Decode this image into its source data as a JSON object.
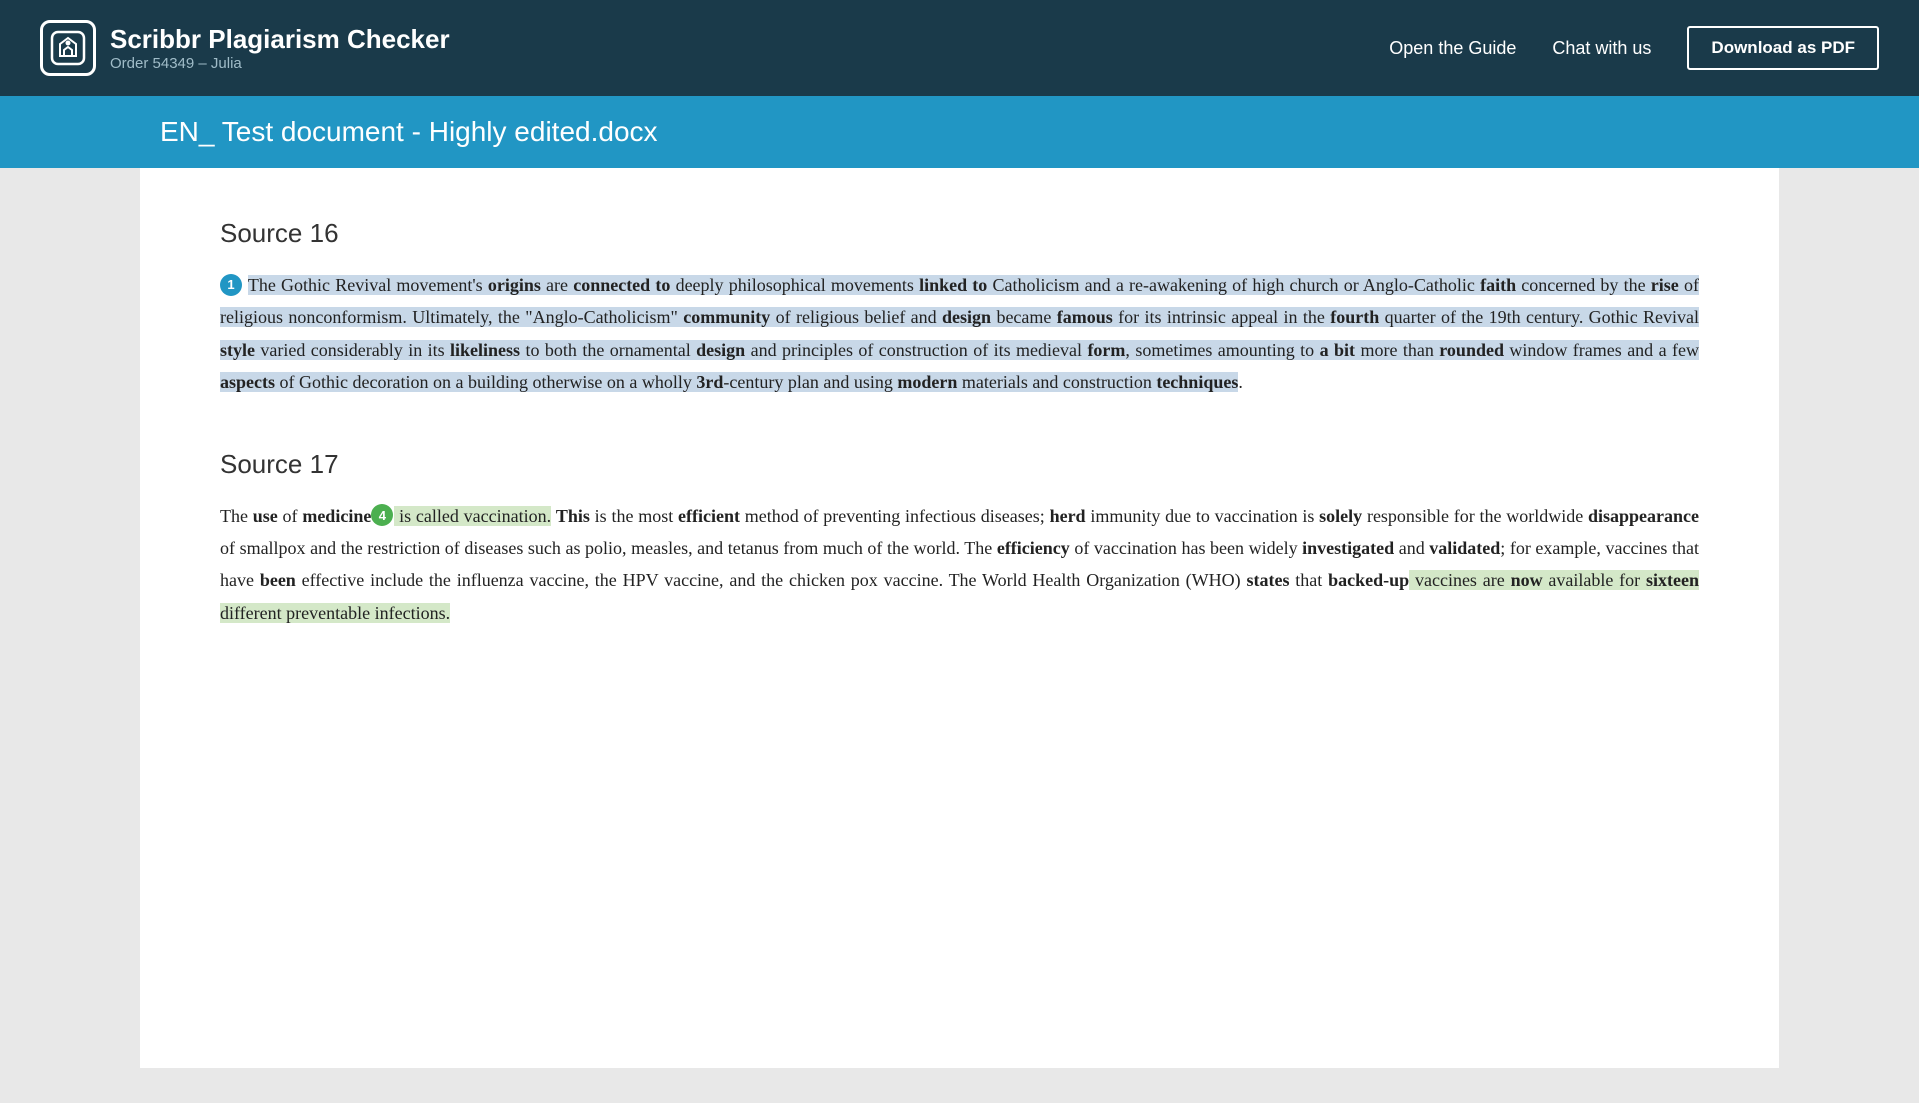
{
  "header": {
    "logo_title": "Scribbr Plagiarism Checker",
    "order_info": "Order 54349 – Julia",
    "nav": {
      "guide": "Open the Guide",
      "chat": "Chat with us",
      "download": "Download as PDF"
    }
  },
  "title_bar": {
    "filename": "EN_ Test document - Highly edited.docx"
  },
  "sources": [
    {
      "id": "source16",
      "heading": "Source 16",
      "badge_number": "1",
      "badge_color": "blue",
      "paragraphs": [
        {
          "segments": [
            {
              "text": "The ",
              "style": "hl-blue"
            },
            {
              "text": "Gothic Revival movement's ",
              "style": "hl-blue"
            },
            {
              "text": "origins",
              "style": "hl-blue bold"
            },
            {
              "text": " are ",
              "style": "hl-blue"
            },
            {
              "text": "connected to",
              "style": "hl-blue bold"
            },
            {
              "text": " deeply philosophical movements ",
              "style": "hl-blue"
            },
            {
              "text": "linked to",
              "style": "hl-blue bold"
            },
            {
              "text": " Catholicism and a re-awakening of high church or Anglo-Catholic ",
              "style": "hl-blue"
            },
            {
              "text": "faith",
              "style": "hl-blue bold"
            },
            {
              "text": " concerned by the ",
              "style": "hl-blue"
            },
            {
              "text": "rise",
              "style": "hl-blue bold"
            },
            {
              "text": " of religious nonconformism. Ultimately, the \"Anglo-Catholicism\" ",
              "style": "hl-blue"
            },
            {
              "text": "community",
              "style": "hl-blue bold"
            },
            {
              "text": " of religious belief and ",
              "style": "hl-blue"
            },
            {
              "text": "design",
              "style": "hl-blue bold"
            },
            {
              "text": " became ",
              "style": "hl-blue"
            },
            {
              "text": "famous",
              "style": "hl-blue bold"
            },
            {
              "text": " for its intrinsic appeal in the ",
              "style": "hl-blue"
            },
            {
              "text": "fourth",
              "style": "hl-blue bold"
            },
            {
              "text": " quarter of the 19th century. Gothic Revival ",
              "style": "hl-blue"
            },
            {
              "text": "style",
              "style": "hl-blue bold"
            },
            {
              "text": " varied considerably in its ",
              "style": "hl-blue"
            },
            {
              "text": "likeliness",
              "style": "hl-blue bold"
            },
            {
              "text": " to both the ornamental ",
              "style": "hl-blue"
            },
            {
              "text": "design",
              "style": "hl-blue bold"
            },
            {
              "text": " and principles of construction of its medieval ",
              "style": "hl-blue"
            },
            {
              "text": "form",
              "style": "hl-blue bold"
            },
            {
              "text": ", sometimes amounting to ",
              "style": "hl-blue"
            },
            {
              "text": "a bit",
              "style": "hl-blue bold"
            },
            {
              "text": " more than ",
              "style": "hl-blue"
            },
            {
              "text": "rounded",
              "style": "hl-blue bold"
            },
            {
              "text": " window frames and a few ",
              "style": "hl-blue"
            },
            {
              "text": "aspects",
              "style": "hl-blue bold"
            },
            {
              "text": " of Gothic decoration on a building otherwise on a wholly ",
              "style": "hl-blue"
            },
            {
              "text": "3rd",
              "style": "hl-blue bold"
            },
            {
              "text": "-century plan and using ",
              "style": "hl-blue"
            },
            {
              "text": "modern",
              "style": "hl-blue bold"
            },
            {
              "text": " materials and construction ",
              "style": "hl-blue"
            },
            {
              "text": "techniques",
              "style": "hl-blue bold"
            },
            {
              "text": ".",
              "style": ""
            }
          ]
        }
      ]
    },
    {
      "id": "source17",
      "heading": "Source 17",
      "badge_number": "4",
      "badge_color": "green",
      "paragraphs": [
        {
          "segments": [
            {
              "text": "The ",
              "style": ""
            },
            {
              "text": "use",
              "style": "bold"
            },
            {
              "text": " of ",
              "style": ""
            },
            {
              "text": "medicine",
              "style": "bold"
            },
            {
              "text": " is called vaccination. ",
              "style": "hl-yellow"
            },
            {
              "text": "This",
              "style": "bold"
            },
            {
              "text": " is the most ",
              "style": ""
            },
            {
              "text": "efficient",
              "style": "bold"
            },
            {
              "text": " method of preventing infectious diseases; ",
              "style": ""
            },
            {
              "text": "herd",
              "style": "bold"
            },
            {
              "text": " immunity due to vaccination is ",
              "style": ""
            },
            {
              "text": "solely",
              "style": "bold"
            },
            {
              "text": " responsible for the worldwide ",
              "style": ""
            },
            {
              "text": "disappearance",
              "style": "bold"
            },
            {
              "text": " of smallpox and the restriction of diseases such as polio, measles, and tetanus from much of the world. The ",
              "style": ""
            },
            {
              "text": "efficiency",
              "style": "bold"
            },
            {
              "text": " of vaccination has been widely ",
              "style": ""
            },
            {
              "text": "investigated",
              "style": "bold"
            },
            {
              "text": " and ",
              "style": ""
            },
            {
              "text": "validated",
              "style": "bold"
            },
            {
              "text": "; for example, vaccines that have ",
              "style": ""
            },
            {
              "text": "been",
              "style": "bold"
            },
            {
              "text": " effective include the influenza vaccine, the HPV vaccine, and the chicken pox vaccine. The World Health Organization (WHO) ",
              "style": ""
            },
            {
              "text": "states",
              "style": "bold"
            },
            {
              "text": " that ",
              "style": ""
            },
            {
              "text": "backed-up",
              "style": "bold"
            },
            {
              "text": " vaccines are ",
              "style": "hl-yellow"
            },
            {
              "text": "now",
              "style": "hl-yellow bold"
            },
            {
              "text": " available for ",
              "style": "hl-yellow"
            },
            {
              "text": "sixteen",
              "style": "hl-yellow bold"
            },
            {
              "text": " different preventable infections.",
              "style": ""
            }
          ]
        }
      ]
    }
  ]
}
